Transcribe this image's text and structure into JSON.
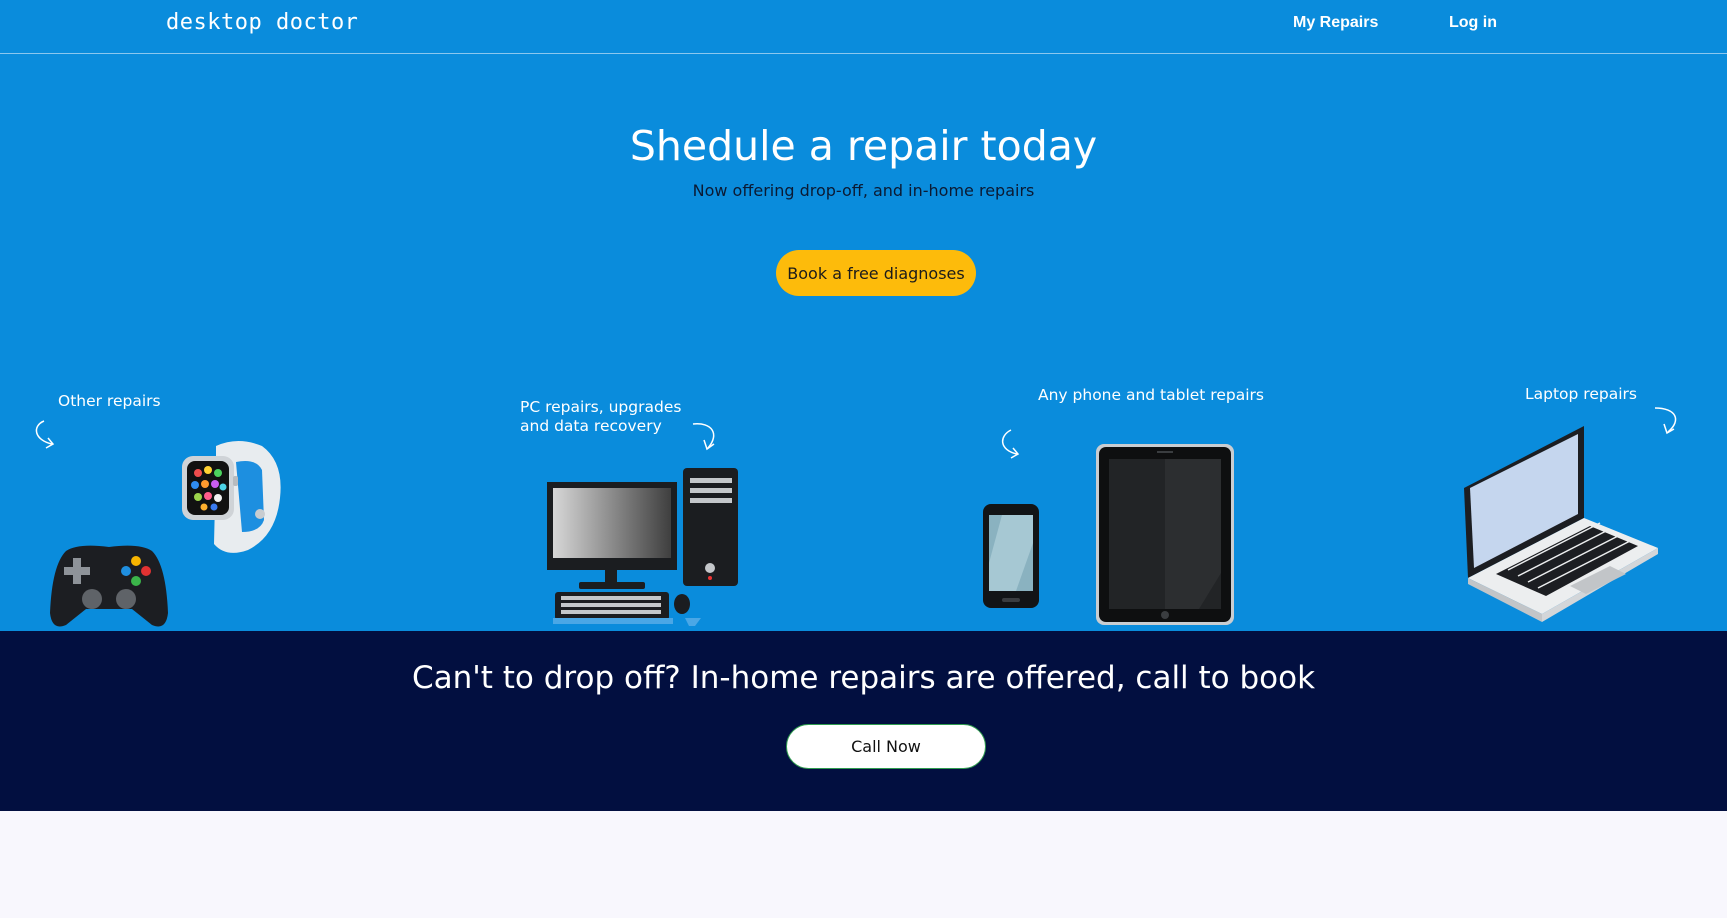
{
  "nav": {
    "logo": "desktop doctor",
    "links": [
      "My Repairs",
      "Log in"
    ]
  },
  "hero": {
    "title": "Shedule a repair today",
    "subtitle": "Now offering drop-off, and in-home repairs",
    "cta": "Book a free diagnoses"
  },
  "categories": [
    {
      "label": "Other repairs",
      "icons": [
        "game-controller-icon",
        "smartwatch-icon"
      ]
    },
    {
      "label_line1": "PC repairs, upgrades",
      "label_line2": "and data recovery",
      "icons": [
        "desktop-computer-icon"
      ]
    },
    {
      "label": "Any phone and tablet repairs",
      "icons": [
        "phone-icon",
        "tablet-icon"
      ]
    },
    {
      "label": "Laptop  repairs",
      "icons": [
        "laptop-icon"
      ]
    }
  ],
  "band": {
    "title": "Can't to drop off? In-home repairs are offered, call to book",
    "button": "Call Now"
  },
  "colors": {
    "hero_bg": "#0a8cdc",
    "band_bg": "#020f40",
    "cta_bg": "#fdbb0b",
    "page_bg": "#f8f7fd"
  }
}
